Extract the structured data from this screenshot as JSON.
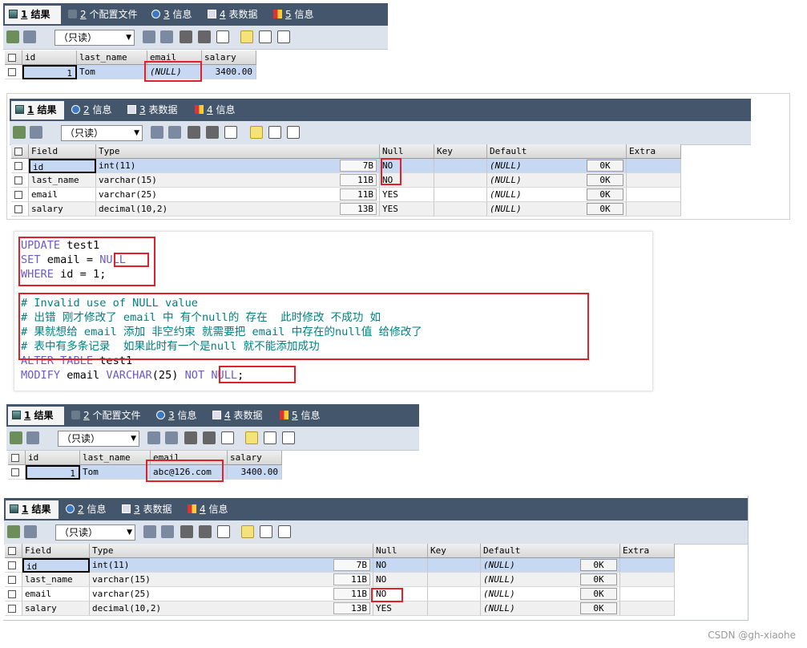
{
  "panel1": {
    "tabs": [
      {
        "num": "1",
        "label": "结果"
      },
      {
        "num": "2",
        "label": "个配置文件"
      },
      {
        "num": "3",
        "label": "信息"
      },
      {
        "num": "4",
        "label": "表数据"
      },
      {
        "num": "5",
        "label": "信息"
      }
    ],
    "mode_select": "（只读）",
    "columns": [
      "id",
      "last_name",
      "email",
      "salary"
    ],
    "rows": [
      {
        "id": "1",
        "last_name": "Tom",
        "email": "(NULL)",
        "salary": "3400.00"
      }
    ]
  },
  "panel2": {
    "tabs": [
      {
        "num": "1",
        "label": "结果"
      },
      {
        "num": "2",
        "label": "信息"
      },
      {
        "num": "3",
        "label": "表数据"
      },
      {
        "num": "4",
        "label": "信息"
      }
    ],
    "mode_select": "（只读）",
    "columns": [
      "Field",
      "Type",
      "Null",
      "Key",
      "Default",
      "Extra"
    ],
    "rows": [
      {
        "field": "id",
        "type": "int(11)",
        "size": "7B",
        "null": "NO",
        "key": "",
        "default": "(NULL)",
        "default_size": "0K",
        "extra": ""
      },
      {
        "field": "last_name",
        "type": "varchar(15)",
        "size": "11B",
        "null": "NO",
        "key": "",
        "default": "(NULL)",
        "default_size": "0K",
        "extra": ""
      },
      {
        "field": "email",
        "type": "varchar(25)",
        "size": "11B",
        "null": "YES",
        "key": "",
        "default": "(NULL)",
        "default_size": "0K",
        "extra": ""
      },
      {
        "field": "salary",
        "type": "decimal(10,2)",
        "size": "13B",
        "null": "YES",
        "key": "",
        "default": "(NULL)",
        "default_size": "0K",
        "extra": ""
      }
    ]
  },
  "code": {
    "lines": [
      [
        {
          "t": "UPDATE",
          "c": "kw"
        },
        {
          "t": " test1",
          "c": "pl"
        }
      ],
      [
        {
          "t": "SET",
          "c": "kw"
        },
        {
          "t": " email = ",
          "c": "pl"
        },
        {
          "t": "NULL",
          "c": "kw"
        }
      ],
      [
        {
          "t": "WHERE",
          "c": "kw"
        },
        {
          "t": " id = 1;",
          "c": "pl"
        }
      ],
      [
        {
          "t": "",
          "c": "pl"
        }
      ],
      [
        {
          "t": "# Invalid use of NULL value",
          "c": "cm"
        }
      ],
      [
        {
          "t": "# 出错 刚才修改了 email 中 有个null的 存在  此时修改 不成功 如",
          "c": "cm"
        }
      ],
      [
        {
          "t": "# 果就想给 email 添加 非空约束 就需要把 email 中存在的null值 给修改了",
          "c": "cm"
        }
      ],
      [
        {
          "t": "# 表中有多条记录  如果此时有一个是null 就不能添加成功",
          "c": "cm"
        }
      ],
      [
        {
          "t": "ALTER TABLE",
          "c": "kw"
        },
        {
          "t": " test1",
          "c": "pl"
        }
      ],
      [
        {
          "t": "MODIFY",
          "c": "kw"
        },
        {
          "t": " email ",
          "c": "pl"
        },
        {
          "t": "VARCHAR",
          "c": "kw"
        },
        {
          "t": "(25) ",
          "c": "pl"
        },
        {
          "t": "NOT NULL",
          "c": "kw"
        },
        {
          "t": ";",
          "c": "pl"
        }
      ]
    ]
  },
  "panel3": {
    "tabs": [
      {
        "num": "1",
        "label": "结果"
      },
      {
        "num": "2",
        "label": "个配置文件"
      },
      {
        "num": "3",
        "label": "信息"
      },
      {
        "num": "4",
        "label": "表数据"
      },
      {
        "num": "5",
        "label": "信息"
      }
    ],
    "mode_select": "（只读）",
    "columns": [
      "id",
      "last_name",
      "email",
      "salary"
    ],
    "rows": [
      {
        "id": "1",
        "last_name": "Tom",
        "email": "abc@126.com",
        "salary": "3400.00"
      }
    ]
  },
  "panel4": {
    "tabs": [
      {
        "num": "1",
        "label": "结果"
      },
      {
        "num": "2",
        "label": "信息"
      },
      {
        "num": "3",
        "label": "表数据"
      },
      {
        "num": "4",
        "label": "信息"
      }
    ],
    "mode_select": "（只读）",
    "columns": [
      "Field",
      "Type",
      "Null",
      "Key",
      "Default",
      "Extra"
    ],
    "rows": [
      {
        "field": "id",
        "type": "int(11)",
        "size": "7B",
        "null": "NO",
        "key": "",
        "default": "(NULL)",
        "default_size": "0K",
        "extra": ""
      },
      {
        "field": "last_name",
        "type": "varchar(15)",
        "size": "11B",
        "null": "NO",
        "key": "",
        "default": "(NULL)",
        "default_size": "0K",
        "extra": ""
      },
      {
        "field": "email",
        "type": "varchar(25)",
        "size": "11B",
        "null": "NO",
        "key": "",
        "default": "(NULL)",
        "default_size": "0K",
        "extra": ""
      },
      {
        "field": "salary",
        "type": "decimal(10,2)",
        "size": "13B",
        "null": "YES",
        "key": "",
        "default": "(NULL)",
        "default_size": "0K",
        "extra": ""
      }
    ]
  },
  "watermark": "CSDN @gh-xiaohe",
  "colors": {
    "tabbar": "#43566b",
    "toolbar": "#dce3ec",
    "selected_row": "#c6d8f2",
    "highlight": "#e0202a",
    "keyword": "#6a5acd",
    "comment": "#008080"
  }
}
